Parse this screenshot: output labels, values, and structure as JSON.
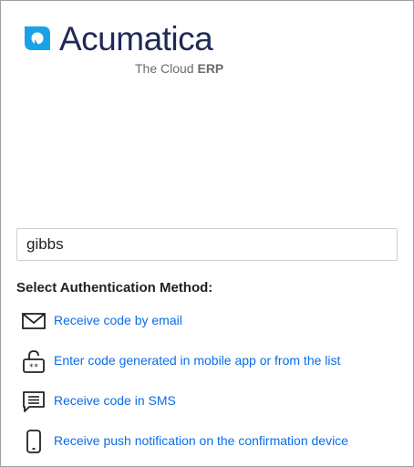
{
  "brand": {
    "name": "Acumatica",
    "tagline_prefix": "The Cloud",
    "tagline_bold": "ERP",
    "colors": {
      "primary": "#1f2a56",
      "accent": "#1aa2e6",
      "link": "#0a6ce8"
    }
  },
  "login": {
    "username_value": "gibbs"
  },
  "auth": {
    "title": "Select Authentication Method:",
    "methods": [
      {
        "icon": "envelope-icon",
        "label": "Receive code by email"
      },
      {
        "icon": "unlock-code-icon",
        "label": "Enter code generated in mobile app or from the list"
      },
      {
        "icon": "sms-message-icon",
        "label": "Receive code in SMS"
      },
      {
        "icon": "mobile-device-icon",
        "label": "Receive push notification on the confirmation device"
      }
    ]
  }
}
